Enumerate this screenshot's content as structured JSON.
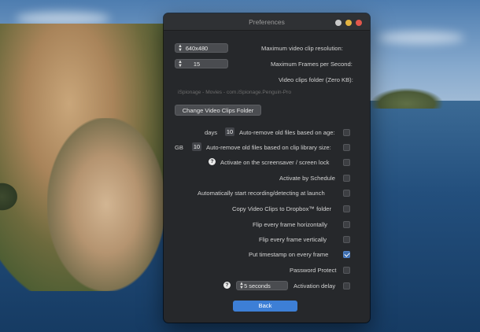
{
  "window": {
    "title": "Preferences"
  },
  "resolution": {
    "label": "Maximum video clip resolution:",
    "value": "640x480"
  },
  "fps": {
    "label": "Maximum Frames per Second:",
    "value": "15"
  },
  "folder": {
    "label": "Video clips folder (Zero KB):",
    "path": "iSpionage - Movies - com.iSpionage.Penguin-Pro",
    "change_button": "Change Video Clips Folder"
  },
  "options": {
    "auto_remove_age": {
      "label": "Auto-remove old files based on age:",
      "value": "10",
      "unit": "days",
      "checked": false
    },
    "auto_remove_size": {
      "label": "Auto-remove old files based on clip library size:",
      "value": "10",
      "unit": "GB",
      "checked": false
    },
    "screensaver": {
      "label": "Activate on the screensaver / screen lock",
      "checked": false
    },
    "schedule": {
      "label": "Activate by Schedule",
      "checked": false
    },
    "auto_start": {
      "label": "Automatically start recording/detecting at launch",
      "checked": false
    },
    "dropbox": {
      "label": "Copy Video Clips to Dropbox™ folder",
      "checked": false
    },
    "flip_h": {
      "label": "Flip every frame horizontally",
      "checked": false
    },
    "flip_v": {
      "label": "Flip every frame vertically",
      "checked": false
    },
    "timestamp": {
      "label": "Put timestamp on every frame",
      "checked": true
    },
    "password": {
      "label": "Password Protect",
      "checked": false
    },
    "delay": {
      "label": "Activation delay",
      "value": "5 seconds",
      "checked": false
    }
  },
  "back_button": "Back",
  "colors": {
    "window_bg": "#26282b",
    "accent": "#3d7fd6"
  }
}
